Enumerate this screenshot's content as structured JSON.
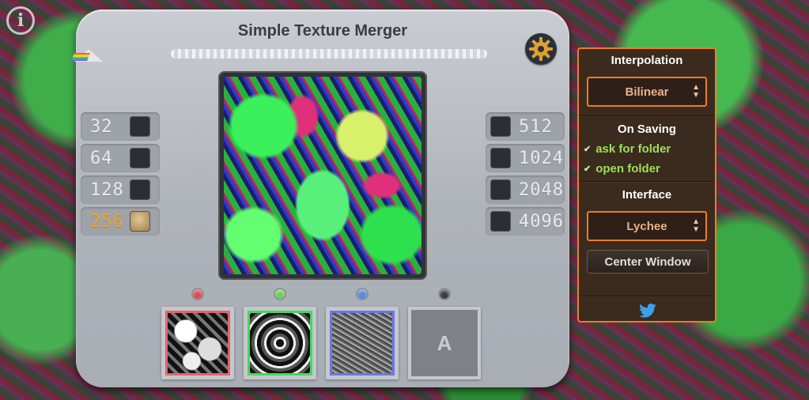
{
  "app": {
    "title": "Simple Texture Merger",
    "info_icon_label": "i"
  },
  "resolutions": {
    "left": [
      {
        "label": "32",
        "selected": false
      },
      {
        "label": "64",
        "selected": false
      },
      {
        "label": "128",
        "selected": false
      },
      {
        "label": "256",
        "selected": true
      }
    ],
    "right": [
      {
        "label": "512",
        "selected": false
      },
      {
        "label": "1024",
        "selected": false
      },
      {
        "label": "2048",
        "selected": false
      },
      {
        "label": "4096",
        "selected": false
      }
    ],
    "active_color": "#f3a41f"
  },
  "channels": [
    {
      "name": "red",
      "color": "#e3646a",
      "dot_color": "#e04a55"
    },
    {
      "name": "green",
      "color": "#47d85c",
      "dot_color": "#6fd05a"
    },
    {
      "name": "blue",
      "color": "#6a78e0",
      "dot_color": "#5a8ad8"
    },
    {
      "name": "alpha",
      "label": "A",
      "dot_color": "#3a3d42"
    }
  ],
  "settings": {
    "interpolation": {
      "title": "Interpolation",
      "value": "Bilinear"
    },
    "on_saving": {
      "title": "On Saving",
      "options": [
        {
          "label": "ask for folder",
          "checked": true
        },
        {
          "label": "open folder",
          "checked": true
        }
      ]
    },
    "interface": {
      "title": "Interface",
      "value": "Lychee"
    },
    "center_window_label": "Center Window",
    "accent_color": "#f07d1f"
  },
  "icons": {
    "info": "info-icon",
    "settings": "gear-icon",
    "twitter": "twitter-icon"
  }
}
